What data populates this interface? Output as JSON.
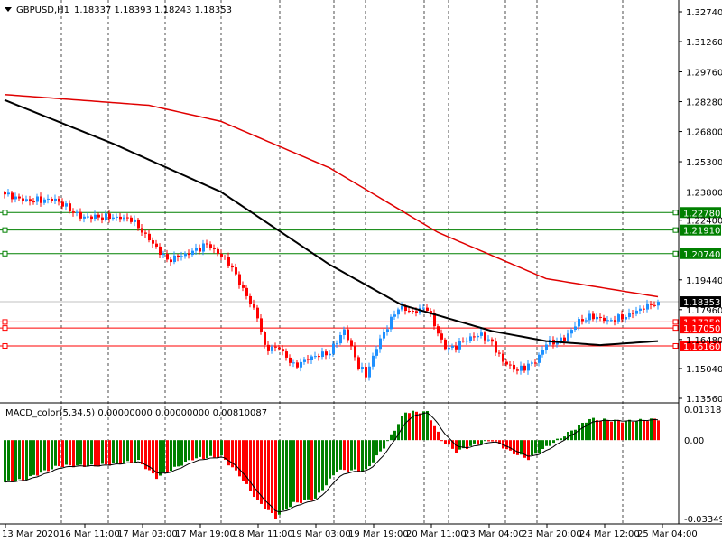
{
  "chart_data": [
    {
      "type": "candlestick",
      "title": "GBPUSD,H1",
      "ohlc_header": "1.18337 1.18393 1.18243 1.18353",
      "price_ticks": [
        "1.32740",
        "1.31260",
        "1.29760",
        "1.28280",
        "1.26800",
        "1.25300",
        "1.23800",
        "1.22400",
        "1.19440",
        "1.17960",
        "1.16480",
        "1.15040",
        "1.13560"
      ],
      "ylim": [
        1.1356,
        1.3274
      ],
      "time_labels": [
        "13 Mar 2020",
        "16 Mar 11:00",
        "17 Mar 03:00",
        "17 Mar 19:00",
        "18 Mar 11:00",
        "19 Mar 03:00",
        "19 Mar 19:00",
        "20 Mar 11:00",
        "23 Mar 04:00",
        "23 Mar 20:00",
        "24 Mar 12:00",
        "25 Mar 04:00"
      ],
      "candle_count": 182,
      "close_waypoints": [
        [
          0,
          1.2368
        ],
        [
          6,
          1.2337
        ],
        [
          14,
          1.2343
        ],
        [
          21,
          1.2256
        ],
        [
          29,
          1.2256
        ],
        [
          35,
          1.2247
        ],
        [
          40,
          1.2144
        ],
        [
          45,
          1.2041
        ],
        [
          51,
          1.2076
        ],
        [
          56,
          1.2121
        ],
        [
          62,
          1.2032
        ],
        [
          66,
          1.1897
        ],
        [
          70,
          1.1763
        ],
        [
          72,
          1.1606
        ],
        [
          76,
          1.1606
        ],
        [
          80,
          1.1516
        ],
        [
          85,
          1.1561
        ],
        [
          90,
          1.1583
        ],
        [
          94,
          1.1696
        ],
        [
          98,
          1.1516
        ],
        [
          100,
          1.1471
        ],
        [
          104,
          1.1651
        ],
        [
          109,
          1.1807
        ],
        [
          113,
          1.1785
        ],
        [
          117,
          1.1807
        ],
        [
          119,
          1.1718
        ],
        [
          122,
          1.1606
        ],
        [
          124,
          1.1606
        ],
        [
          128,
          1.1651
        ],
        [
          132,
          1.1673
        ],
        [
          135,
          1.1628
        ],
        [
          138,
          1.1538
        ],
        [
          142,
          1.1494
        ],
        [
          147,
          1.1538
        ],
        [
          150,
          1.1628
        ],
        [
          155,
          1.1651
        ],
        [
          159,
          1.174
        ],
        [
          163,
          1.1763
        ],
        [
          167,
          1.174
        ],
        [
          172,
          1.1763
        ],
        [
          177,
          1.1807
        ],
        [
          181,
          1.18353
        ]
      ],
      "ma_slow_waypoints": [
        [
          0,
          1.2863
        ],
        [
          40,
          1.281
        ],
        [
          60,
          1.273
        ],
        [
          90,
          1.25
        ],
        [
          120,
          1.218
        ],
        [
          150,
          1.195
        ],
        [
          181,
          1.186
        ]
      ],
      "ma_fast_waypoints": [
        [
          0,
          1.2836
        ],
        [
          30,
          1.262
        ],
        [
          60,
          1.238
        ],
        [
          90,
          1.202
        ],
        [
          110,
          1.182
        ],
        [
          135,
          1.169
        ],
        [
          150,
          1.164
        ],
        [
          165,
          1.162
        ],
        [
          181,
          1.164
        ]
      ],
      "levels": [
        {
          "price": "1.22780",
          "color": "#008000"
        },
        {
          "price": "1.21910",
          "color": "#008000"
        },
        {
          "price": "1.20740",
          "color": "#008000"
        },
        {
          "price": "1.18353",
          "color": "#000000"
        },
        {
          "price": "1.17350",
          "color": "#ff0000"
        },
        {
          "price": "1.17050",
          "color": "#ff0000"
        },
        {
          "price": "1.16160",
          "color": "#ff0000"
        }
      ],
      "colors": {
        "up": "#1e90ff",
        "down": "#ff0000",
        "ma_slow": "#e00000",
        "ma_fast": "#000000"
      }
    },
    {
      "type": "bar",
      "title": "MACD_color(5,34,5) 0.00000000 0.00000000 0.00810087",
      "ticks": [
        "0.0131853",
        "0.00",
        "-0.033496"
      ],
      "ylim": [
        -0.033496,
        0.0131853
      ],
      "hist_waypoints": [
        [
          0,
          -0.018
        ],
        [
          5,
          -0.017
        ],
        [
          15,
          -0.011
        ],
        [
          25,
          -0.011
        ],
        [
          37,
          -0.009
        ],
        [
          42,
          -0.016
        ],
        [
          52,
          -0.008
        ],
        [
          60,
          -0.007
        ],
        [
          65,
          -0.015
        ],
        [
          70,
          -0.026
        ],
        [
          75,
          -0.033
        ],
        [
          80,
          -0.027
        ],
        [
          86,
          -0.025
        ],
        [
          92,
          -0.013
        ],
        [
          100,
          -0.013
        ],
        [
          105,
          -0.003
        ],
        [
          111,
          0.012
        ],
        [
          117,
          0.012
        ],
        [
          121,
          0
        ],
        [
          125,
          -0.005
        ],
        [
          130,
          -0.002
        ],
        [
          135,
          0
        ],
        [
          140,
          -0.005
        ],
        [
          145,
          -0.008
        ],
        [
          150,
          -0.003
        ],
        [
          155,
          0.002
        ],
        [
          162,
          0.009
        ],
        [
          172,
          0.008
        ],
        [
          181,
          0.009
        ]
      ],
      "colors": {
        "up": "#008000",
        "down": "#ff0000"
      }
    }
  ]
}
